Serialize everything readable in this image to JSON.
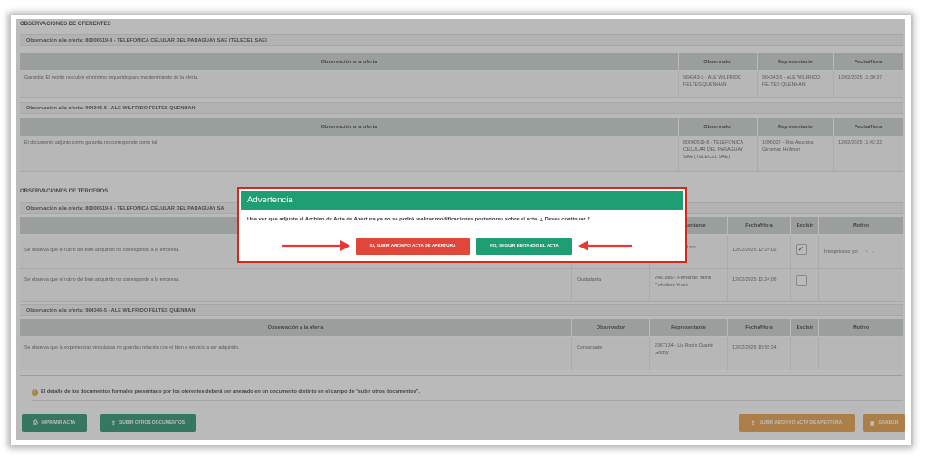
{
  "observaciones_oferentes": {
    "title": "OBSERVACIONES DE OFERENTES",
    "groups": [
      {
        "subtitle": "Observación a la oferta: 80000519-8 - TELEFONICA CELULAR DEL PARAGUAY SAE (TELECEL SAE)",
        "headers": [
          "Observación a la oferta",
          "Observador",
          "Representante",
          "Fecha/Hora"
        ],
        "rows": [
          {
            "observacion": "Garantía: El monto no cubre el mínimo requerido para mantenimiento de la oferta.",
            "observador": "964343-5 - ALE WILFRIDO FELTES QUENHAN",
            "representante": "964343-5 - ALE WILFRIDO FELTES QUENHAN",
            "fecha": "12/02/2025 11:30:37"
          }
        ]
      },
      {
        "subtitle": "Observación a la oferta: 964343-5 - ALE WILFRIDO FELTES QUENHAN",
        "headers": [
          "Observación a la oferta",
          "Observador",
          "Representante",
          "Fecha/Hora"
        ],
        "rows": [
          {
            "observacion": "El documento adjunto como garantía no corresponde como tal.",
            "observador": "80000519-8 - TELEFONICA CELULAR DEL PARAGUAY SAE (TELECEL SAE)",
            "representante": "1096022 - Rita Asucena Gimenez Hellman",
            "fecha": "12/02/2025 11:42:22"
          }
        ]
      }
    ]
  },
  "observaciones_terceros": {
    "title": "OBSERVACIONES DE TERCEROS",
    "groups": [
      {
        "subtitle": "Observación a la oferta: 80000519-8 - TELEFONICA CELULAR DEL PARAGUAY SA",
        "headers": [
          "Observación a la oferta",
          "Observador",
          "Representante",
          "Fecha/Hora",
          "Excluir",
          "Motivo"
        ],
        "rows": [
          {
            "observacion": "Se observa que el rubro del bien adquirido no corresponde a la empresa.",
            "observador": "",
            "representante": "Fernando Yamil rris",
            "fecha": "12/02/2025 12:24:02",
            "excluir": "✓",
            "motivo": "Irrespetuoso y/o"
          },
          {
            "observacion": "Se observa que el rubro del bien adquirido no corresponde a la empresa.",
            "observador": "Ciudadanía",
            "representante": "2481880 - Fernando Yamil Caballero Yunis",
            "fecha": "12/02/2025 12:24:06",
            "excluir": "",
            "motivo": ""
          }
        ]
      },
      {
        "subtitle": "Observación a la oferta: 964343-5 - ALE WILFRIDO FELTES QUENHAN",
        "headers": [
          "Observación a la oferta",
          "Observador",
          "Representante",
          "Fecha/Hora",
          "Excluir",
          "Motivo"
        ],
        "rows": [
          {
            "observacion": "Se observa que la experiencias vinculadas no guardan relación con el bien o servicio a ser adquirido.",
            "observador": "Convocante",
            "representante": "2367134 - Liz Rocío Duarte Godoy",
            "fecha": "12/02/2025 10:55:24",
            "excluir": "",
            "motivo": ""
          }
        ]
      }
    ]
  },
  "note": {
    "icon": "info-icon",
    "text": "El detalle de los documentos formales presentado por los oferentes deberá ser anexado en un documento distinto en el campo de \"subir otros documentos\"."
  },
  "footer_buttons": {
    "imprimir": "IMPRIMIR ACTA",
    "subir_otros": "SUBIR OTROS DOCUMENTOS",
    "subir_acta": "SUBIR ARCHIVO ACTA DE APERTURA",
    "grabar": "GRABAR"
  },
  "modal": {
    "title": "Advertencia",
    "message": "Una vez que adjunte el Archivo de Acta de Apertura ya no se podrá realizar modificaciones posteriores sobre el acta. ¿ Desea continuar ?",
    "confirm_label": "SI, SUBIR ARCHIVO ACTA DE APERTURA",
    "cancel_label": "NO, SEGUIR EDITANDO EL ACTA"
  },
  "colors": {
    "modal_header": "#1f9e74",
    "confirm": "#e0463a",
    "cancel": "#1f9e74",
    "highlight": "#d9261c",
    "arrow": "#e53935",
    "green_button": "#1d8c68",
    "orange_button": "#e89a3c"
  }
}
